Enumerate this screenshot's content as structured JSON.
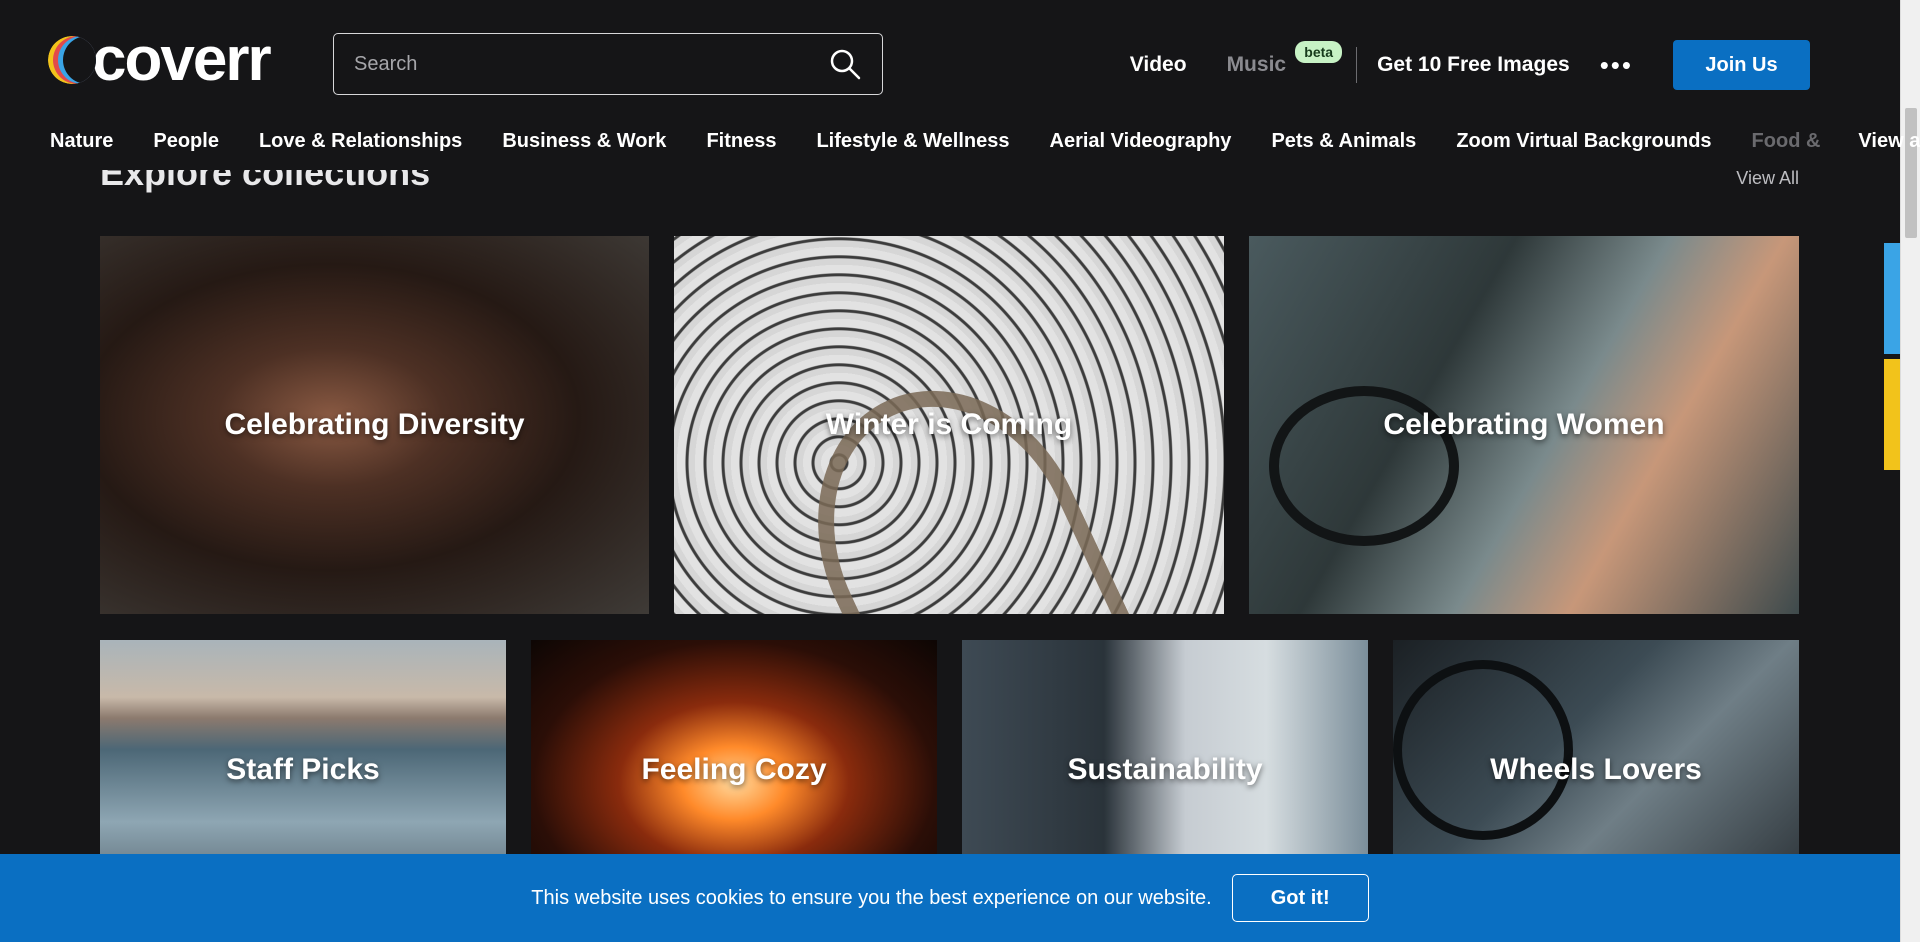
{
  "header": {
    "logo_text": "coverr",
    "search_placeholder": "Search",
    "nav": {
      "video": "Video",
      "music": "Music",
      "music_badge": "beta",
      "free_images": "Get 10 Free Images",
      "more": "•••",
      "join": "Join Us"
    },
    "categories": [
      "Nature",
      "People",
      "Love & Relationships",
      "Business & Work",
      "Fitness",
      "Lifestyle & Wellness",
      "Aerial Videography",
      "Pets & Animals",
      "Zoom Virtual Backgrounds",
      "Food &"
    ],
    "view_all": "View all"
  },
  "section": {
    "title": "Explore collections",
    "view_all": "View All"
  },
  "collections": [
    {
      "label": "Celebrating Diversity"
    },
    {
      "label": "Winter is Coming"
    },
    {
      "label": "Celebrating Women"
    },
    {
      "label": "Staff Picks"
    },
    {
      "label": "Feeling Cozy"
    },
    {
      "label": "Sustainability"
    },
    {
      "label": "Wheels Lovers"
    }
  ],
  "cookie": {
    "message": "This website uses cookies to ensure you the best experience on our website.",
    "button": "Got it!"
  },
  "colors": {
    "background": "#151517",
    "accent": "#0a6fc2",
    "beta_badge": "#c7f2c5",
    "side_tab_blue": "#3aa4e6",
    "side_tab_yellow": "#f2c31b"
  }
}
